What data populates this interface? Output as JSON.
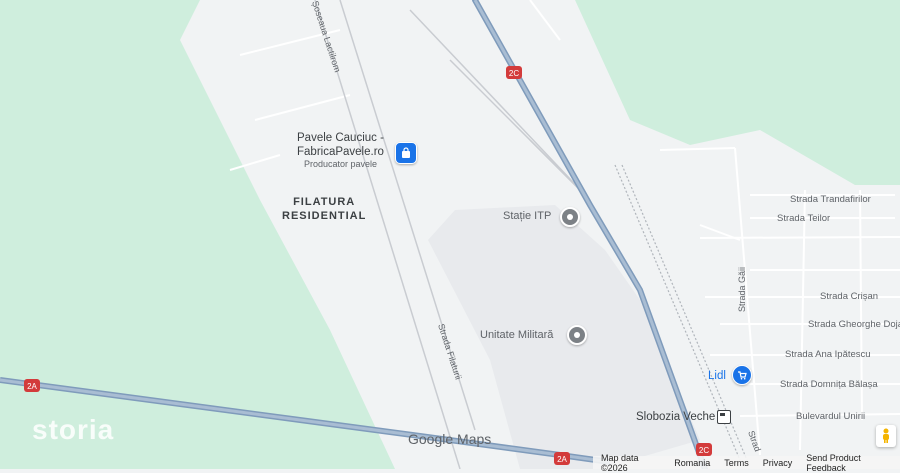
{
  "map": {
    "colors": {
      "green": "#cfeedd",
      "urban": "#f1f3f4",
      "military": "#e8eaed",
      "highway": "#8ba4c0",
      "road": "#ffffff",
      "poi_pin": "#7c8186",
      "shop_pin": "#1a73e8"
    },
    "area_labels": {
      "filatura_line1": "FILATURA",
      "filatura_line2": "RESIDENTIAL"
    },
    "pois": {
      "pavele_line1": "Pavele Cauciuc -",
      "pavele_line2": "FabricaPavele.ro",
      "pavele_sub": "Producator pavele",
      "statie_itp": "Stație ITP",
      "unitate_militara": "Unitate Militară",
      "lidl": "Lidl",
      "slobozia_veche": "Slobozia Veche"
    },
    "streets": {
      "soseaua_lactilrom": "Șoseaua Lactilrom",
      "strada_filaturii": "Strada Filaturii",
      "trandafirilor": "Strada Trandafirilor",
      "teilor": "Strada Teilor",
      "crisan": "Strada Crișan",
      "gheorghe_doja": "Strada Gheorghe Doja",
      "ana_ipatescu": "Strada Ana Ipătescu",
      "domnita_balasa": "Strada Domnița Bălașa",
      "bulevardul_unirii": "Bulevardul Unirii",
      "strada_gaii": "Strada Găii",
      "strada_cut": "Strad"
    },
    "route_shields": {
      "r2c_top": "2C",
      "r2a_left": "2A",
      "r2a_bottom": "2A",
      "r2c_bottom": "2C"
    },
    "icons": {
      "shop": "shopping-bag-icon",
      "poi": "location-pin-icon",
      "transit": "train-station-icon",
      "pegman": "pegman-icon"
    }
  },
  "overlay": {
    "watermark": "storia",
    "google_logo": "Google Maps"
  },
  "footer": {
    "map_data": "Map data ©2026",
    "region": "Romania",
    "terms": "Terms",
    "privacy": "Privacy",
    "feedback": "Send Product Feedback"
  }
}
